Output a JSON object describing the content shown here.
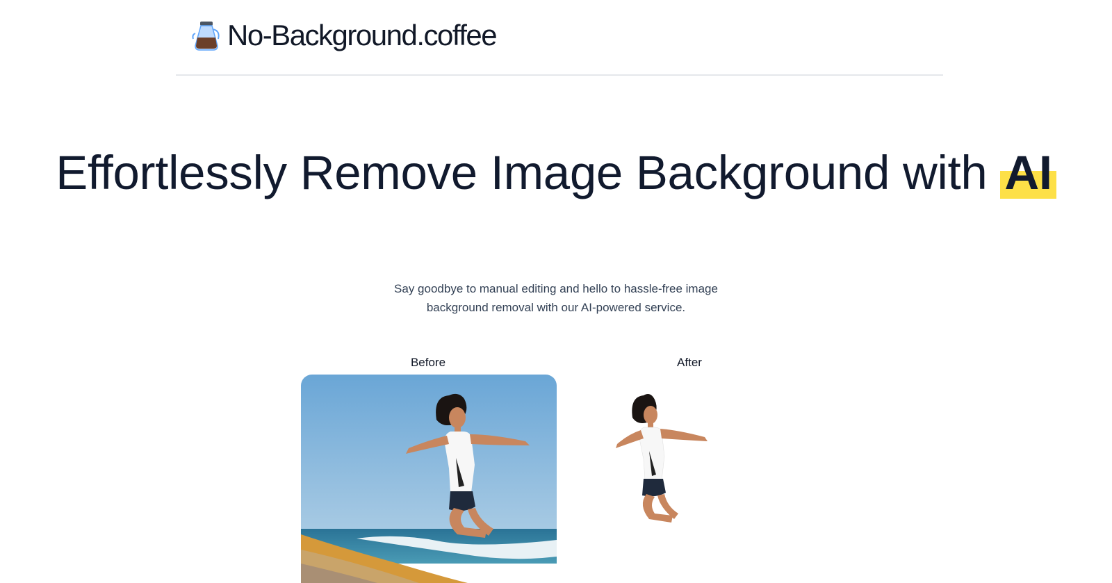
{
  "header": {
    "brand": "No-Background.coffee",
    "brand_icon": "coffee-pot-icon"
  },
  "hero": {
    "headline_main": "Effortlessly Remove Image Background with ",
    "headline_highlight": "AI",
    "subtext": "Say goodbye to manual editing and hello to hassle-free image background removal with our AI-powered service."
  },
  "comparison": {
    "before_label": "Before",
    "after_label": "After"
  },
  "colors": {
    "highlight": "#fde047",
    "text": "#111a2e",
    "divider": "#e5e7eb",
    "sky": "#7fb0d8",
    "sea": "#2f7ea0",
    "sand": "#d59a3c"
  }
}
